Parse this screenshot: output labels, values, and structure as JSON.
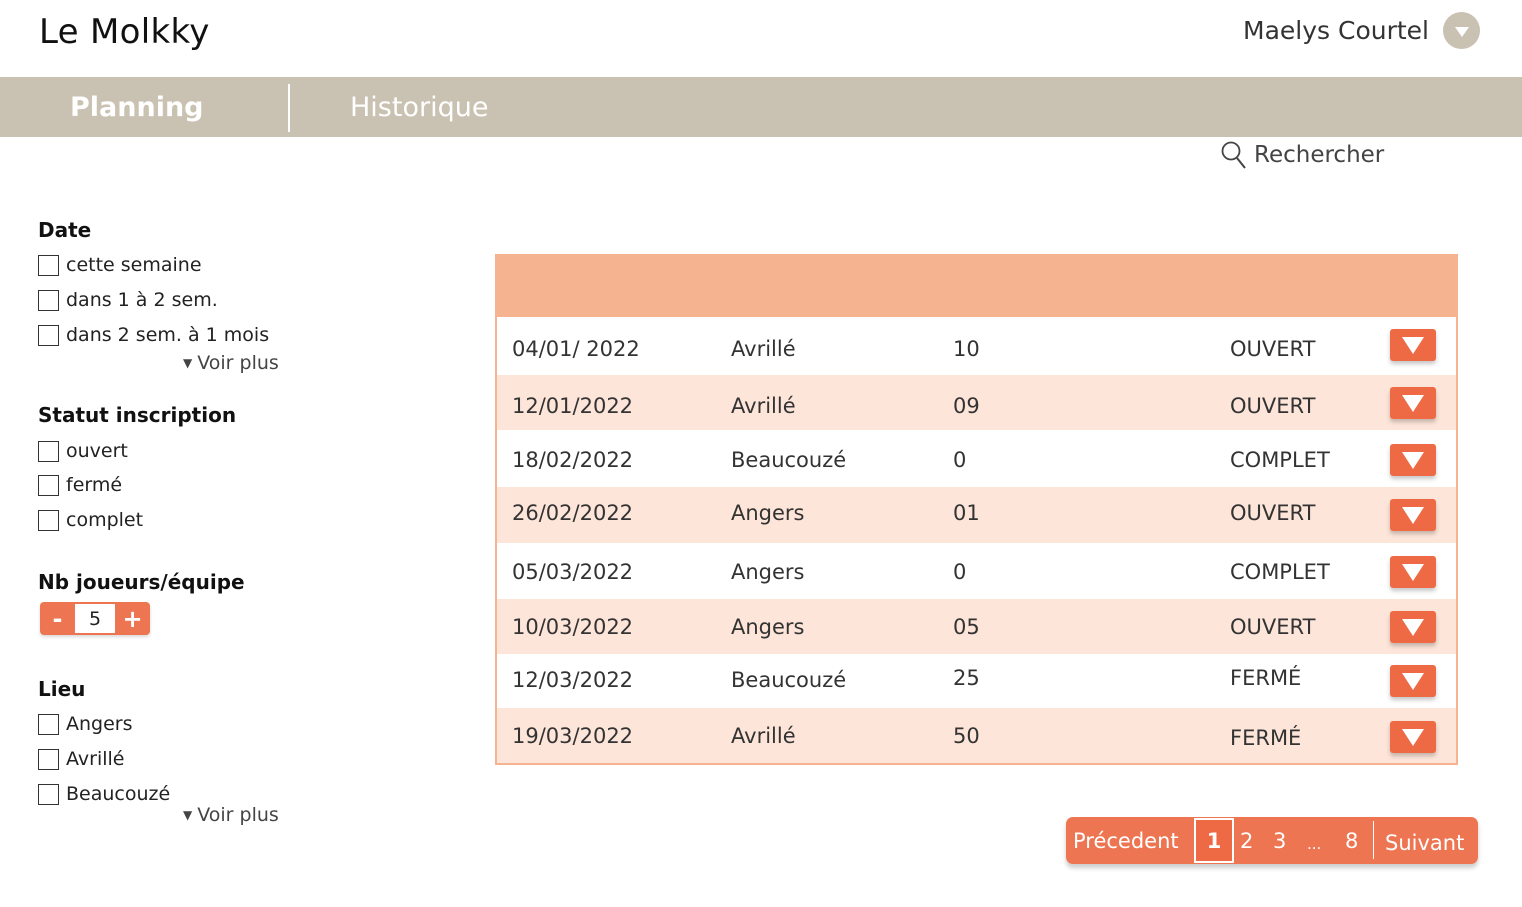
{
  "app": {
    "title": "Le Molkky"
  },
  "user": {
    "name": "Maelys Courtel",
    "menu_icon": "chevron-down-icon"
  },
  "nav": {
    "tabs": [
      {
        "label": "Planning",
        "active": true
      },
      {
        "label": "Historique",
        "active": false
      }
    ]
  },
  "search": {
    "label": "Rechercher",
    "icon": "search-icon"
  },
  "filters": {
    "date": {
      "title": "Date",
      "options": [
        "cette semaine",
        "dans 1 à 2 sem.",
        "dans 2 sem. à 1 mois"
      ],
      "more": "Voir plus"
    },
    "statut": {
      "title": "Statut inscription",
      "options": [
        "ouvert",
        "fermé",
        "complet"
      ]
    },
    "joueurs": {
      "title": "Nb joueurs/équipe",
      "minus": "-",
      "value": "5",
      "plus": "+"
    },
    "lieu": {
      "title": "Lieu",
      "options": [
        "Angers",
        "Avrillé",
        "Beaucouzé"
      ],
      "more": "Voir plus"
    }
  },
  "table": {
    "rows": [
      {
        "date": "04/01/ 2022",
        "lieu": "Avrillé",
        "nb": "10",
        "statut": "OUVERT"
      },
      {
        "date": "12/01/2022",
        "lieu": "Avrillé",
        "nb": "09",
        "statut": "OUVERT"
      },
      {
        "date": "18/02/2022",
        "lieu": "Beaucouzé",
        "nb": "0",
        "statut": "COMPLET"
      },
      {
        "date": "26/02/2022",
        "lieu": "Angers",
        "nb": "01",
        "statut": "OUVERT"
      },
      {
        "date": "05/03/2022",
        "lieu": "Angers",
        "nb": "0",
        "statut": "COMPLET"
      },
      {
        "date": "10/03/2022",
        "lieu": "Angers",
        "nb": "05",
        "statut": "OUVERT"
      },
      {
        "date": "12/03/2022",
        "lieu": "Beaucouzé",
        "nb": "25",
        "statut": "FERMÉ"
      },
      {
        "date": "19/03/2022",
        "lieu": "Avrillé",
        "nb": "50",
        "statut": "FERMÉ"
      }
    ]
  },
  "pagination": {
    "prev": "Précedent",
    "pages": [
      "1",
      "2",
      "3",
      "...",
      "8"
    ],
    "current": "1",
    "next": "Suivant"
  },
  "colors": {
    "accent": "#ee7551",
    "nav": "#c9c1b1",
    "table_header": "#f6b38f",
    "row_alt": "#fde5d9"
  }
}
